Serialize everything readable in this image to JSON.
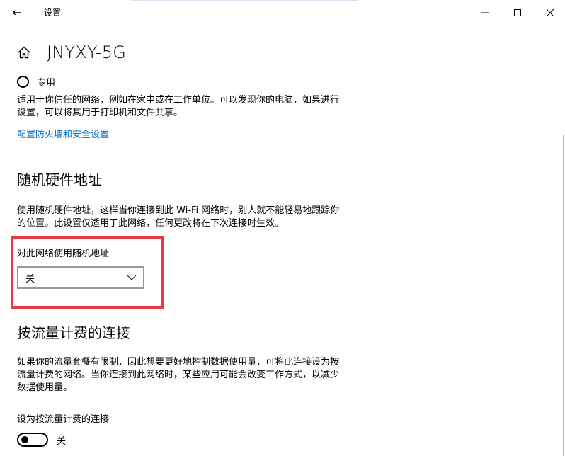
{
  "window": {
    "title": "设置",
    "back_glyph": "←"
  },
  "page": {
    "title": "JNYXY-5G"
  },
  "network_profile": {
    "option_label": "专用",
    "description": "适用于你信任的网络，例如在家中或在工作单位。可以发现你的电脑，如果进行设置，可以将其用于打印机和文件共享。",
    "firewall_link": "配置防火墙和安全设置"
  },
  "random_hw": {
    "heading": "随机硬件地址",
    "description": "使用随机硬件地址，这样当你连接到此 Wi-Fi 网络时，别人就不能轻易地跟踪你的位置。此设置仅适用于此网络，任何更改将在下次连接时生效。",
    "field_label": "对此网络使用随机地址",
    "dropdown_value": "关"
  },
  "metered": {
    "heading": "按流量计费的连接",
    "description": "如果你的流量套餐有限制，因此想要更好地控制数据使用量，可将此连接设为按流量计费的网络。当你连接到此网络时，某些应用可能会改变工作方式，以减少数据使用量。",
    "toggle_label": "设为按流量计费的连接",
    "toggle_state": "关"
  },
  "colors": {
    "link": "#0a6cbf",
    "highlight": "#e63b44"
  }
}
